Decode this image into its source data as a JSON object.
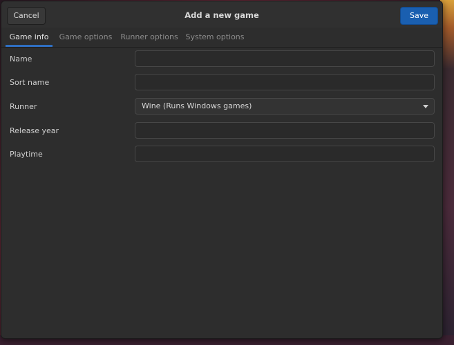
{
  "window": {
    "title": "Add a new game",
    "cancel_label": "Cancel",
    "save_label": "Save"
  },
  "tabs": [
    {
      "label": "Game info",
      "active": true
    },
    {
      "label": "Game options",
      "active": false
    },
    {
      "label": "Runner options",
      "active": false
    },
    {
      "label": "System options",
      "active": false
    }
  ],
  "form": {
    "name": {
      "label": "Name",
      "value": ""
    },
    "sort_name": {
      "label": "Sort name",
      "value": ""
    },
    "runner": {
      "label": "Runner",
      "selected": "Wine (Runs Windows games)"
    },
    "release_year": {
      "label": "Release year",
      "value": ""
    },
    "playtime": {
      "label": "Playtime",
      "value": ""
    }
  },
  "colors": {
    "accent": "#1a5fb0",
    "tab_indicator": "#2f6fc2",
    "dialog_bg": "#2d2d2d"
  },
  "icons": {
    "runner_dropdown": "chevron-down-icon"
  }
}
